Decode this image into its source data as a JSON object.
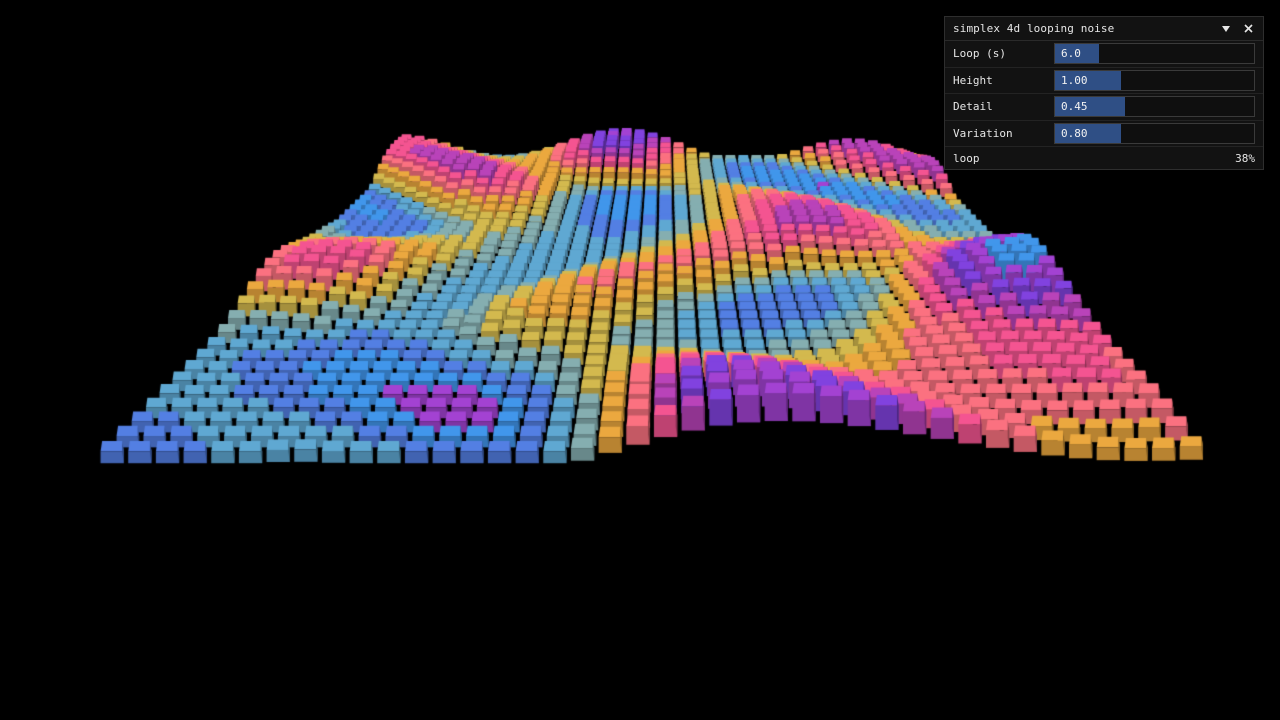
{
  "panel": {
    "title": "simplex 4d looping noise",
    "collapse_icon": "triangle-down-icon",
    "close_icon": "close-icon",
    "controls": [
      {
        "label": "Loop (s)",
        "value": "6.0",
        "fill": 0.22
      },
      {
        "label": "Height",
        "value": "1.00",
        "fill": 0.33
      },
      {
        "label": "Detail",
        "value": "0.45",
        "fill": 0.35
      },
      {
        "label": "Variation",
        "value": "0.80",
        "fill": 0.33
      }
    ],
    "progress": {
      "label": "loop",
      "value": "38%"
    }
  },
  "scene": {
    "background": "#000000",
    "palette": [
      "#7b3fd4",
      "#9b3fc8",
      "#3e8fe0",
      "#4f79d8",
      "#5aa0c8",
      "#7fa6a8",
      "#c9b04a",
      "#e0a03c",
      "#ef6c7a",
      "#e8508a",
      "#b040b0"
    ]
  }
}
